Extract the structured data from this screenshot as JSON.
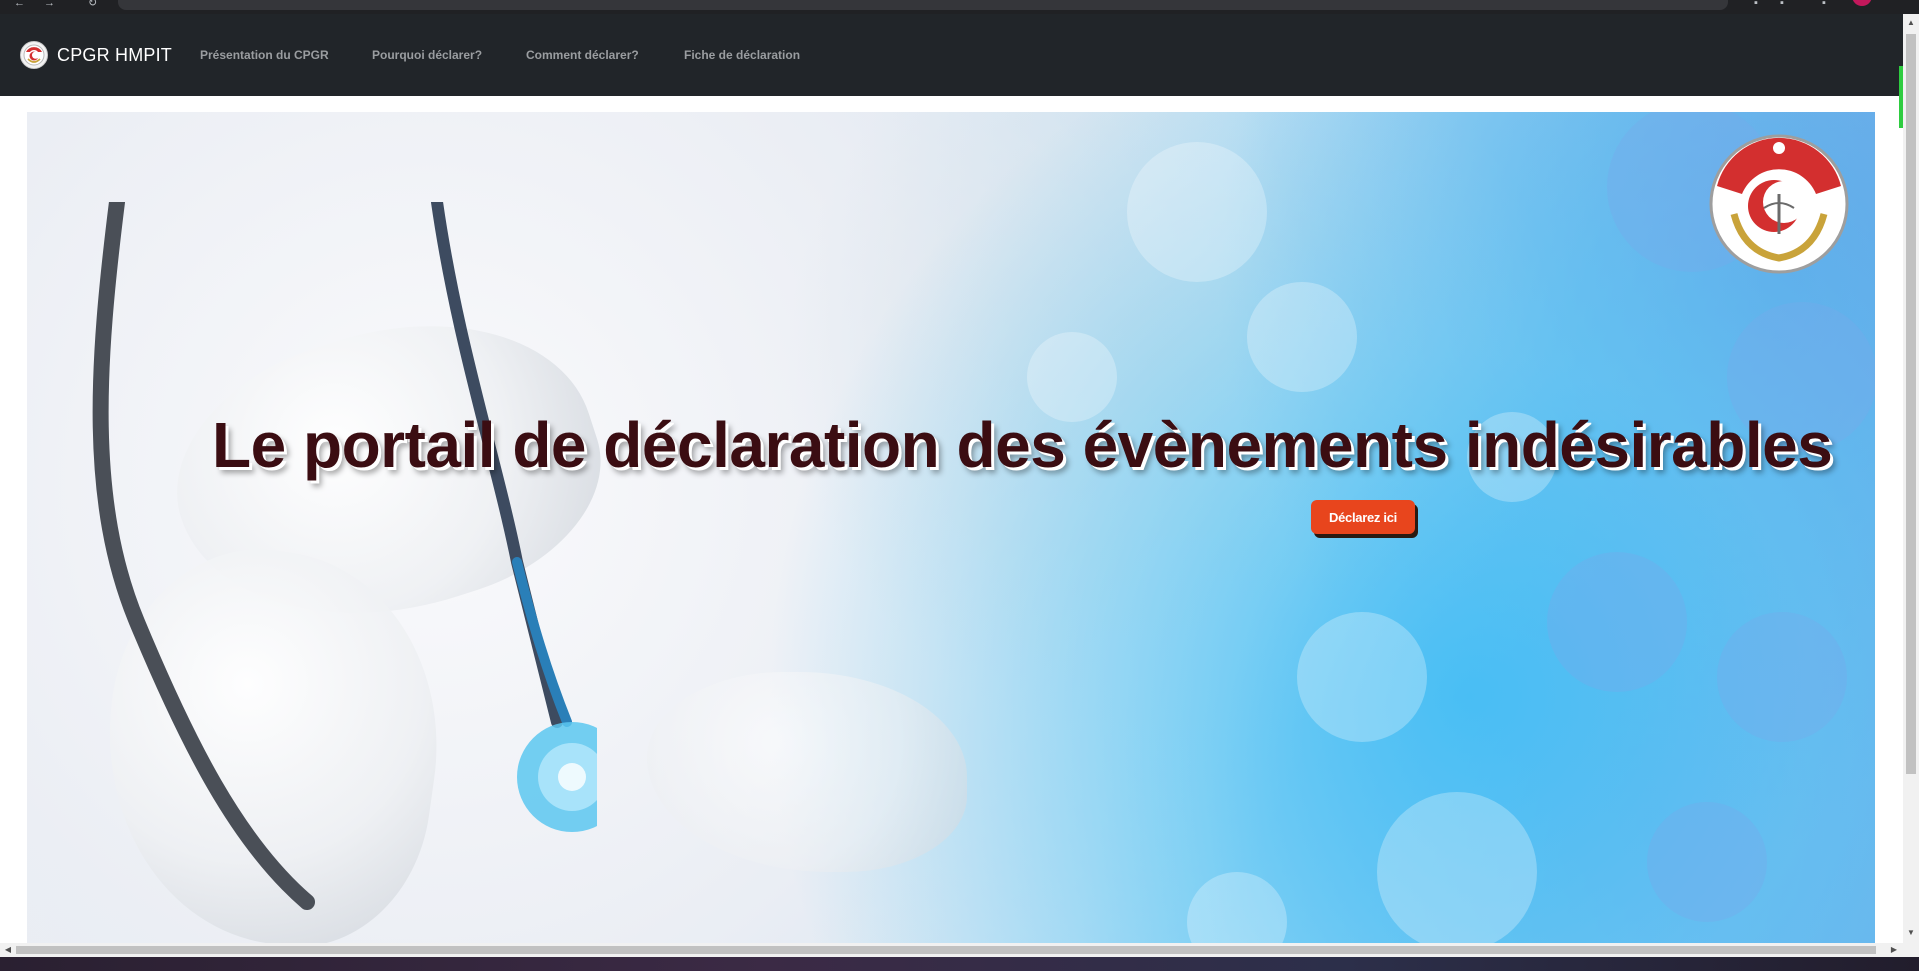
{
  "navbar": {
    "brand": "CPGR HMPIT",
    "links": [
      "Présentation du CPGR",
      "Pourquoi déclarer?",
      "Comment déclarer?",
      "Fiche de déclaration"
    ]
  },
  "hero": {
    "title": "Le portail de déclaration des évènements indésirables",
    "cta_label": "Déclarez ici"
  },
  "icons": {
    "brand_logo": "hospital-emblem-icon",
    "hero_emblem": "military-health-emblem-icon"
  },
  "colors": {
    "navbar_bg": "#212529",
    "nav_link": "#9a9da0",
    "title_text": "#3b0d12",
    "cta_bg": "#e8451d"
  }
}
